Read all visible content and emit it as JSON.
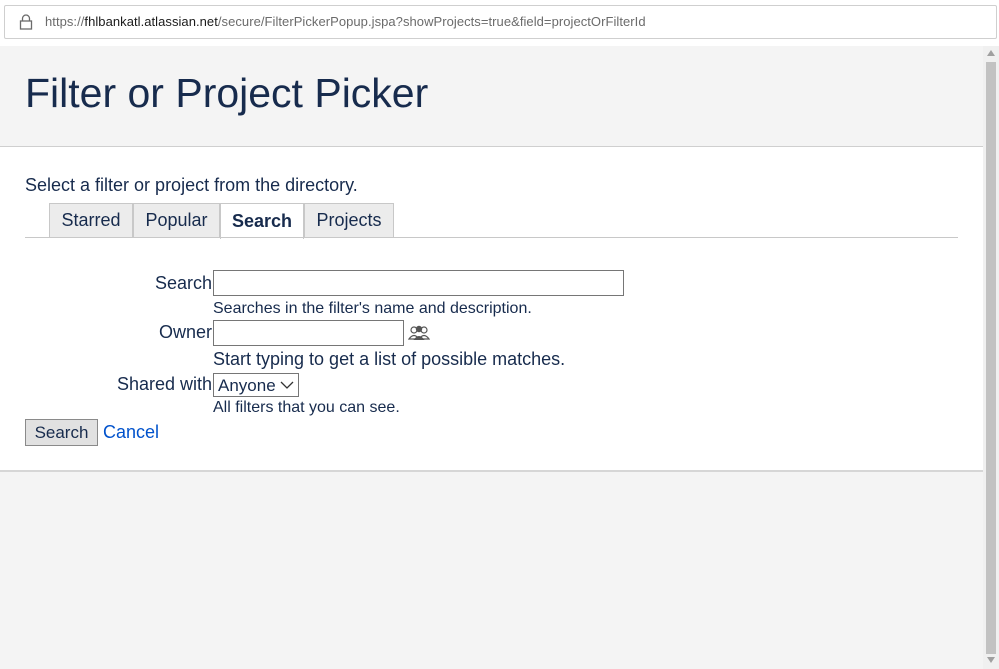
{
  "browser": {
    "url_prefix": "https://",
    "url_host": "fhlbankatl.atlassian.net",
    "url_path": "/secure/FilterPickerPopup.jspa?showProjects=true&field=projectOrFilterId"
  },
  "header": {
    "title": "Filter or Project Picker"
  },
  "main": {
    "intro": "Select a filter or project from the directory.",
    "tabs": [
      {
        "label": "Starred",
        "active": false
      },
      {
        "label": "Popular",
        "active": false
      },
      {
        "label": "Search",
        "active": true
      },
      {
        "label": "Projects",
        "active": false
      }
    ],
    "form": {
      "search_label": "Search",
      "search_value": "",
      "search_hint": "Searches in the filter's name and description.",
      "owner_label": "Owner",
      "owner_value": "",
      "owner_hint": "Start typing to get a list of possible matches.",
      "shared_label": "Shared with",
      "shared_selected": "Anyone",
      "shared_hint": "All filters that you can see.",
      "search_button": "Search",
      "cancel_link": "Cancel"
    }
  },
  "colors": {
    "title": "#172b4d",
    "link": "#0052cc",
    "header_bg": "#f4f4f4",
    "content_bg": "#ffffff"
  },
  "icons": {
    "lock": "lock-icon",
    "user_picker": "user-picker-icon",
    "dropdown": "chevron-down-icon"
  }
}
